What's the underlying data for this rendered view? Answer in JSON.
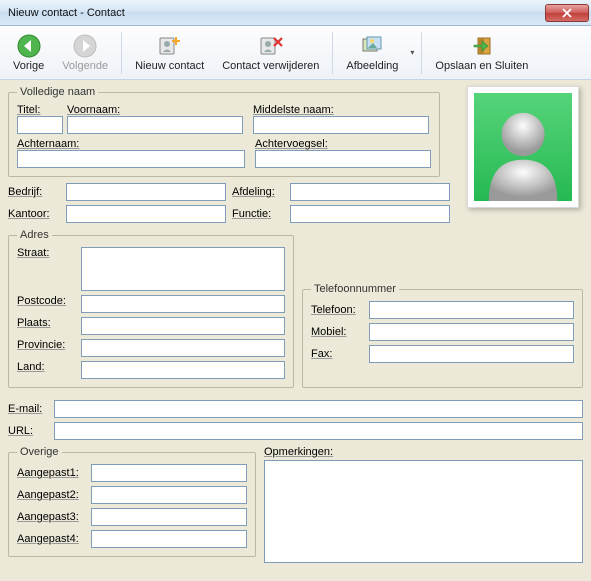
{
  "window": {
    "title": "Nieuw contact - Contact"
  },
  "toolbar": {
    "back": "Vorige",
    "forward": "Volgende",
    "new_contact": "Nieuw contact",
    "delete_contact": "Contact verwijderen",
    "image": "Afbeelding",
    "save_close": "Opslaan en Sluiten"
  },
  "groups": {
    "full_name": "Volledige naam",
    "address": "Adres",
    "phone": "Telefoonnummer",
    "other": "Overige"
  },
  "labels": {
    "title": "Titel:",
    "first_name": "Voornaam:",
    "middle_name": "Middelste naam:",
    "last_name": "Achternaam:",
    "suffix": "Achtervoegsel:",
    "company": "Bedrijf:",
    "department": "Afdeling:",
    "office": "Kantoor:",
    "function": "Functie:",
    "street": "Straat:",
    "postcode": "Postcode:",
    "city": "Plaats:",
    "province": "Provincie:",
    "country": "Land:",
    "telephone": "Telefoon:",
    "mobile": "Mobiel:",
    "fax": "Fax:",
    "email": "E-mail:",
    "url": "URL:",
    "custom1": "Aangepast1:",
    "custom2": "Aangepast2:",
    "custom3": "Aangepast3:",
    "custom4": "Aangepast4:",
    "remarks": "Opmerkingen:"
  },
  "values": {
    "title": "",
    "first_name": "",
    "middle_name": "",
    "last_name": "",
    "suffix": "",
    "company": "",
    "department": "",
    "office": "",
    "function": "",
    "street": "",
    "postcode": "",
    "city": "",
    "province": "",
    "country": "",
    "telephone": "",
    "mobile": "",
    "fax": "",
    "email": "",
    "url": "",
    "custom1": "",
    "custom2": "",
    "custom3": "",
    "custom4": "",
    "remarks": ""
  }
}
